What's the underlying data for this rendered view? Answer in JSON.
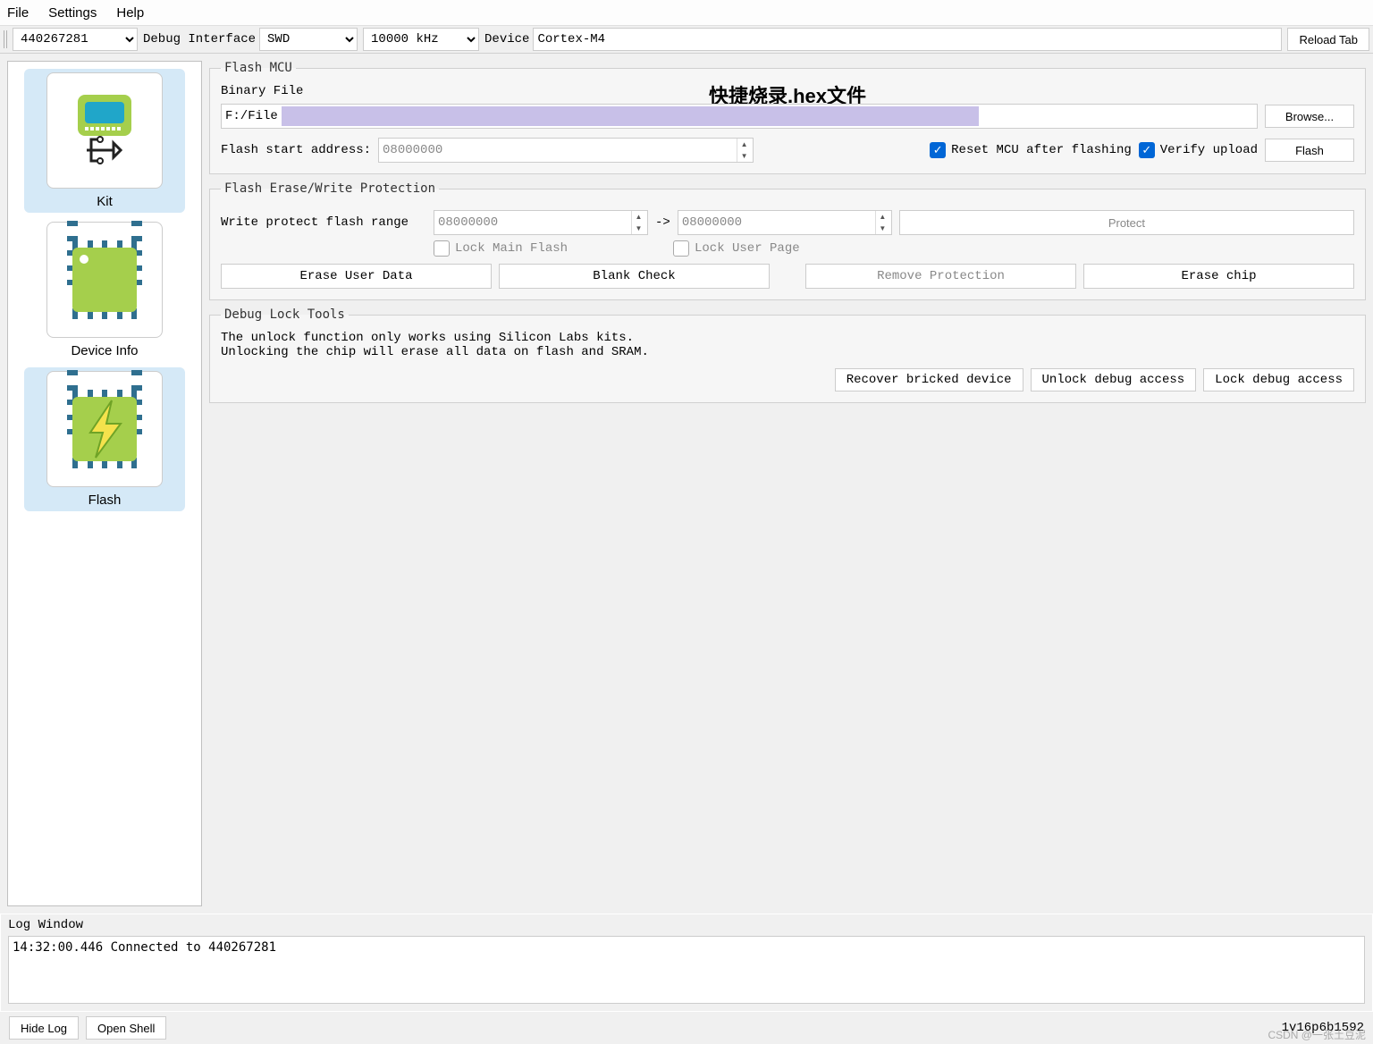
{
  "menubar": {
    "items": [
      "File",
      "Settings",
      "Help"
    ]
  },
  "toolbar": {
    "device_id": "440267281",
    "debug_iface_label": "Debug Interface",
    "interface": "SWD",
    "freq": "10000 kHz",
    "device_label": "Device",
    "device_value": "Cortex-M4",
    "reload": "Reload Tab"
  },
  "sidebar": {
    "items": [
      {
        "label": "Kit"
      },
      {
        "label": "Device Info"
      },
      {
        "label": "Flash"
      }
    ]
  },
  "flash_mcu": {
    "legend": "Flash MCU",
    "overlay_title": "快捷烧录.hex文件",
    "binary_label": "Binary File",
    "file_value": "F:/File                                                                          .hex",
    "browse": "Browse...",
    "start_addr_label": "Flash start address:",
    "start_addr": "08000000",
    "reset_label": "Reset MCU after flashing",
    "verify_label": "Verify upload",
    "flash_btn": "Flash"
  },
  "erase": {
    "legend": "Flash Erase/Write Protection",
    "write_protect_label": "Write protect flash range",
    "from": "08000000",
    "arrow": "->",
    "to": "08000000",
    "protect_btn": "Protect",
    "lock_main": "Lock Main Flash",
    "lock_user": "Lock User Page",
    "erase_user": "Erase User Data",
    "blank": "Blank Check",
    "remove_prot": "Remove Protection",
    "erase_chip": "Erase chip"
  },
  "debug": {
    "legend": "Debug Lock Tools",
    "line1": "The unlock function only works using Silicon Labs kits.",
    "line2": "Unlocking the chip will erase all data on flash and SRAM.",
    "recover": "Recover bricked device",
    "unlock": "Unlock debug access",
    "lock": "Lock debug access"
  },
  "log": {
    "title": "Log Window",
    "line": "14:32:00.446 Connected to 440267281"
  },
  "bottom": {
    "hide": "Hide Log",
    "shell": "Open Shell",
    "version": "1v16p6b1592"
  },
  "watermark": "CSDN @一张土豆泥"
}
